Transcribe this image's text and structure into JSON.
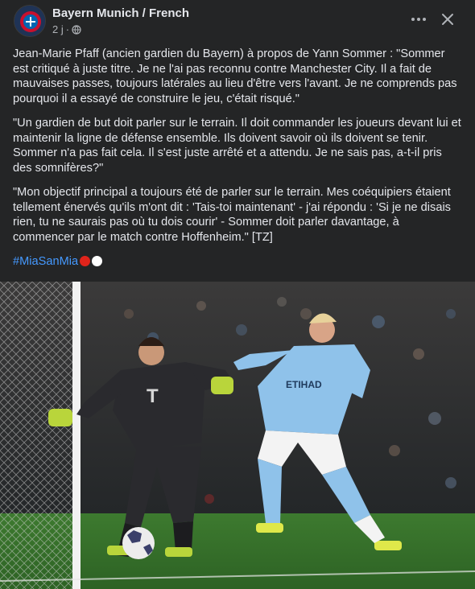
{
  "post": {
    "page_name": "Bayern Munich / French",
    "time": "2 j",
    "time_separator": "·",
    "privacy_icon": "globe-icon",
    "more_icon": "more-horizontal-icon",
    "close_icon": "close-icon",
    "paragraphs": [
      "Jean-Marie Pfaff (ancien gardien du Bayern) à propos de Yann Sommer : \"Sommer est critiqué à juste titre. Je ne l'ai pas reconnu contre Manchester City. Il a fait de mauvaises passes, toujours latérales au lieu d'être vers l'avant. Je ne comprends pas pourquoi il a essayé de construire le jeu, c'était risqué.\"",
      "\"Un gardien de but doit parler sur le terrain. Il doit commander les joueurs devant lui et maintenir la ligne de défense ensemble. Ils doivent savoir où ils doivent se tenir. Sommer n'a pas fait cela. Il s'est juste arrêté et a attendu. Je  ne sais pas, a-t-il pris des somnifères?\"",
      "\"Mon objectif principal a toujours été de parler sur le terrain. Mes coéquipiers étaient tellement énervés qu'ils m'ont dit : 'Tais-toi maintenant' - j'ai répondu : 'Si je ne disais rien, tu ne saurais pas où tu dois courir' - Sommer doit parler davantage, à commencer par le match contre Hoffenheim.\" [TZ]"
    ],
    "hashtag": "#MiaSanMia",
    "hashtag_emoji": [
      "red-circle",
      "white-circle"
    ]
  },
  "colors": {
    "background": "#242526",
    "text": "#e4e6eb",
    "secondary_text": "#b0b3b8",
    "link": "#4599ff",
    "red": "#e0241b",
    "white": "#ffffff"
  }
}
